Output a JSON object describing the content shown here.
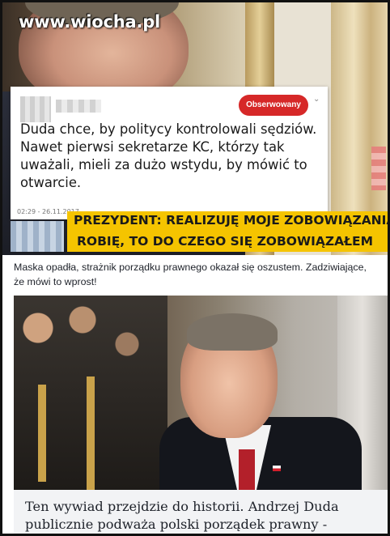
{
  "watermark": {
    "site": "www.wiocha.pl"
  },
  "tweet": {
    "follow_label": "Obserwowany",
    "text": "Duda chce, by politycy kontrolowali sędziów. Nawet pierwsi sekretarze KC, którzy tak uważali, mieli za dużo wstydu, by mówić to otwarcie.",
    "timestamp": "02:29 - 26.11.2017"
  },
  "ticker": {
    "line1": "PREZYDENT: REALIZUJĘ MOJE ZOBOWIĄZANIA,",
    "line2": "ROBIĘ, TO DO CZEGO SIĘ ZOBOWIĄZAŁEM"
  },
  "post": {
    "text": "Maska opadła, strażnik porządku prawnego okazał się oszustem. Zadziwiające, że mówi to wprost!"
  },
  "article": {
    "headline": "Ten wywiad przejdzie do historii. Andrzej Duda publicznie podważa polski porządek prawny -"
  },
  "colors": {
    "follow_button": "#d62828",
    "ticker": "#f5c400"
  }
}
